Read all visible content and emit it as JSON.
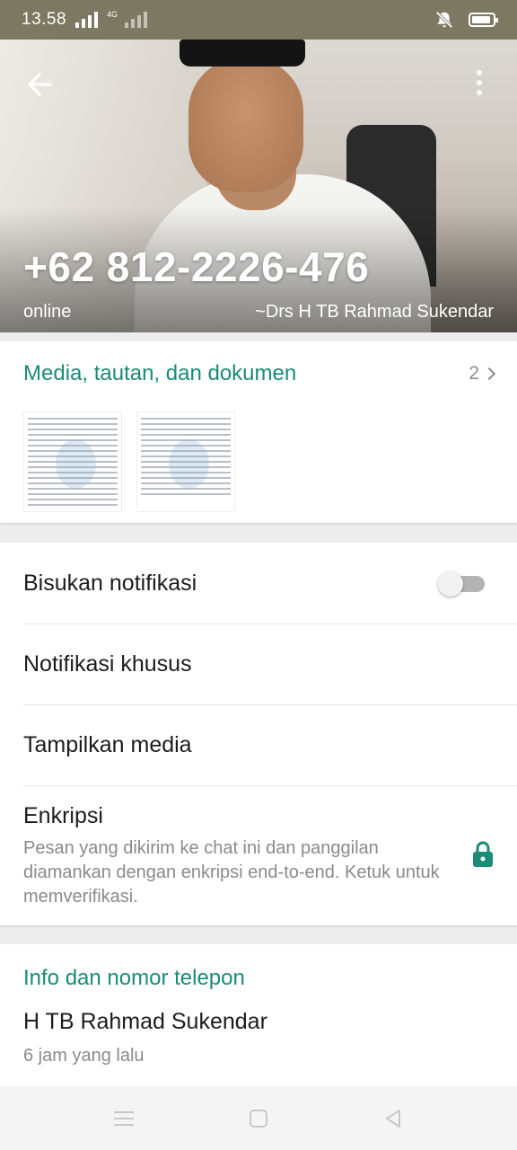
{
  "status_bar": {
    "time": "13.58",
    "network": "4G",
    "icons": [
      "signal-icon",
      "silent-icon",
      "battery-icon"
    ]
  },
  "header": {
    "phone": "+62 812-2226-476",
    "status": "online",
    "push_name": "~Drs H TB Rahmad Sukendar",
    "icons": [
      "back-arrow-icon",
      "more-vert-icon"
    ]
  },
  "media": {
    "title": "Media, tautan, dan dokumen",
    "count": "2",
    "thumbnails": [
      "document-thumbnail-1",
      "document-thumbnail-2"
    ]
  },
  "settings": {
    "mute_label": "Bisukan notifikasi",
    "mute_on": false,
    "custom_notif_label": "Notifikasi khusus",
    "media_visibility_label": "Tampilkan media",
    "encryption_title": "Enkripsi",
    "encryption_desc": "Pesan yang dikirim ke chat ini dan panggilan diamankan dengan enkripsi end-to-end. Ketuk untuk memverifikasi."
  },
  "info": {
    "title": "Info dan nomor telepon",
    "about": "H TB Rahmad Sukendar",
    "about_time": "6 jam yang lalu"
  },
  "colors": {
    "accent": "#1a8b77",
    "status_bar": "#7d7862",
    "secondary_text": "#8a8a8a"
  }
}
